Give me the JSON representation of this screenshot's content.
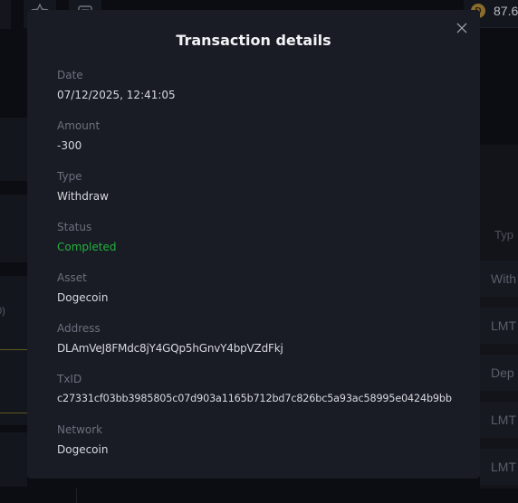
{
  "background": {
    "balance_text": "87.6",
    "coin_symbol": "Ð",
    "table_header": "Typ",
    "rows": [
      "With",
      "LMT",
      "Dep",
      "LMT",
      "LMT"
    ],
    "left_fragment": "0)"
  },
  "modal": {
    "title": "Transaction details",
    "close_icon": "close-icon",
    "fields": {
      "date": {
        "label": "Date",
        "value": "07/12/2025, 12:41:05"
      },
      "amount": {
        "label": "Amount",
        "value": "-300"
      },
      "type": {
        "label": "Type",
        "value": "Withdraw"
      },
      "status": {
        "label": "Status",
        "value": "Completed",
        "color": "#22b23c"
      },
      "asset": {
        "label": "Asset",
        "value": "Dogecoin"
      },
      "address": {
        "label": "Address",
        "value": "DLAmVeJ8FMdc8jY4GQp5hGnvY4bpVZdFkj"
      },
      "txid": {
        "label": "TxID",
        "value": "c27331cf03bb3985805c07d903a1165b712bd7c826bc5a93ac58995e0424b9bb"
      },
      "network": {
        "label": "Network",
        "value": "Dogecoin"
      }
    }
  }
}
